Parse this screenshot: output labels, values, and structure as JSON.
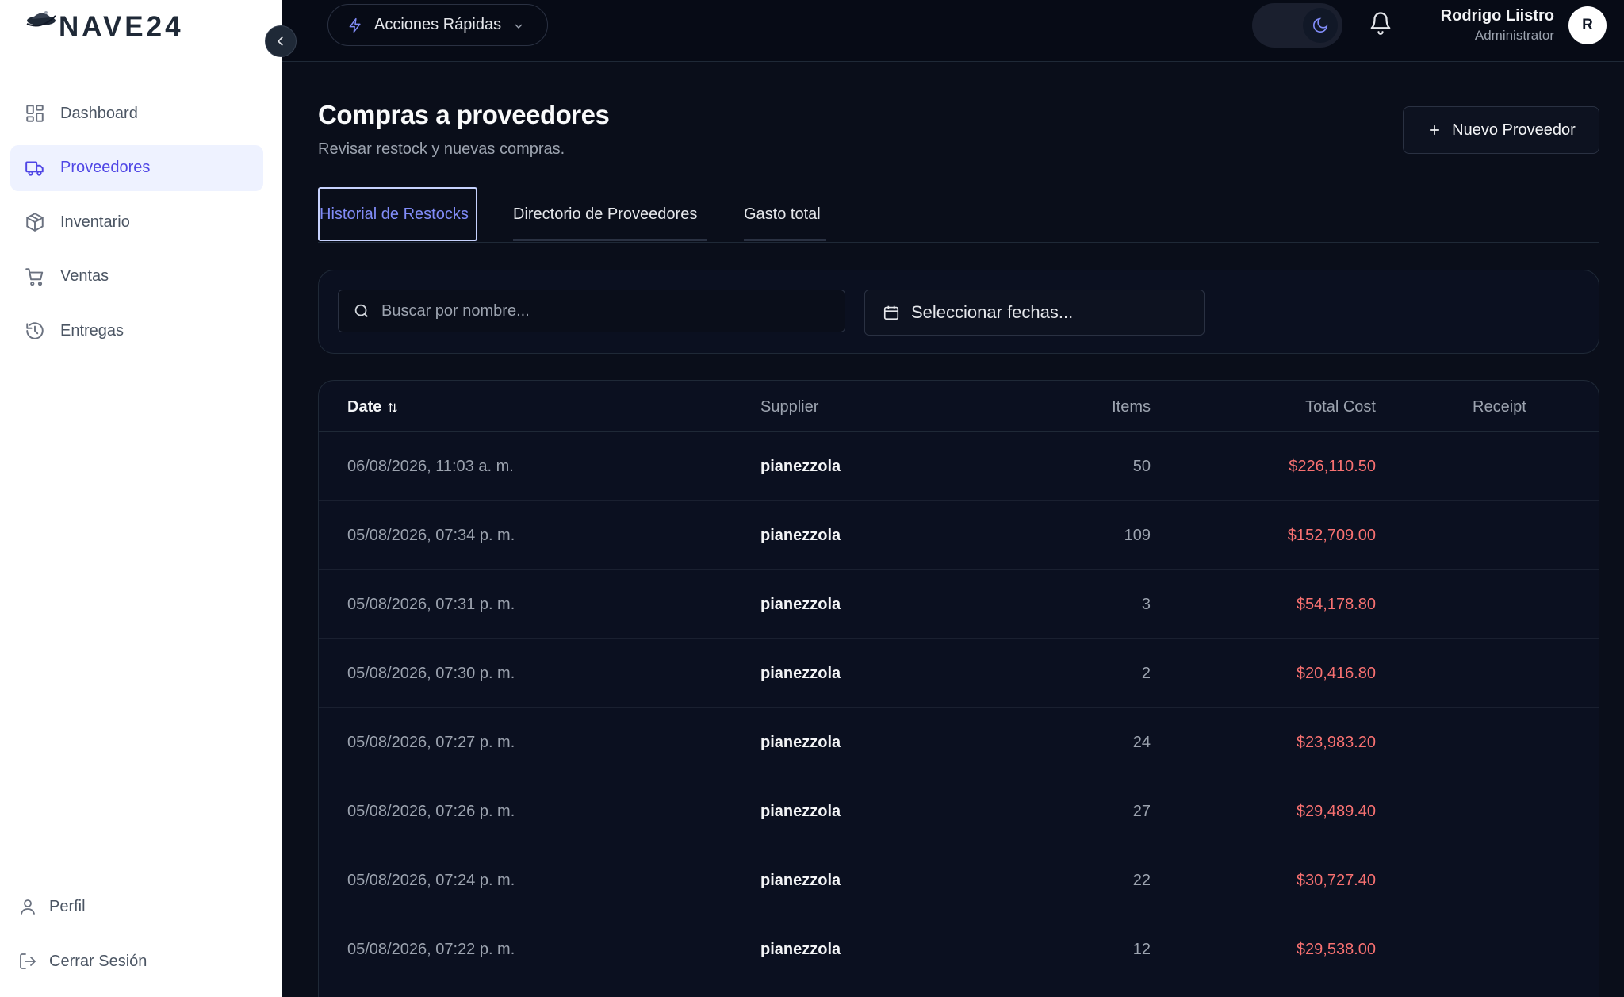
{
  "brand": {
    "name": "NAVE24"
  },
  "sidebar": {
    "items": [
      {
        "label": "Dashboard",
        "icon": "dashboard-icon"
      },
      {
        "label": "Proveedores",
        "icon": "truck-icon",
        "active": true
      },
      {
        "label": "Inventario",
        "icon": "box-icon"
      },
      {
        "label": "Ventas",
        "icon": "cart-icon"
      },
      {
        "label": "Entregas",
        "icon": "history-icon"
      }
    ],
    "bottom": [
      {
        "label": "Perfil",
        "icon": "user-icon"
      },
      {
        "label": "Cerrar Sesión",
        "icon": "logout-icon"
      }
    ]
  },
  "header": {
    "quick_actions": "Acciones Rápidas",
    "user": {
      "name": "Rodrigo Liistro",
      "role": "Administrator",
      "initial": "R"
    }
  },
  "page": {
    "title": "Compras a proveedores",
    "subtitle": "Revisar restock y nuevas compras.",
    "new_button": "Nuevo Proveedor"
  },
  "tabs": [
    {
      "label": "Historial de Restocks",
      "active": true
    },
    {
      "label": "Directorio de Proveedores"
    },
    {
      "label": "Gasto total"
    }
  ],
  "filters": {
    "search_placeholder": "Buscar por nombre...",
    "date_label": "Seleccionar fechas..."
  },
  "table": {
    "columns": {
      "date": "Date",
      "supplier": "Supplier",
      "items": "Items",
      "total": "Total Cost",
      "receipt": "Receipt"
    },
    "rows": [
      {
        "date": "06/08/2026, 11:03 a. m.",
        "supplier": "pianezzola",
        "items": "50",
        "total": "$226,110.50"
      },
      {
        "date": "05/08/2026, 07:34 p. m.",
        "supplier": "pianezzola",
        "items": "109",
        "total": "$152,709.00"
      },
      {
        "date": "05/08/2026, 07:31 p. m.",
        "supplier": "pianezzola",
        "items": "3",
        "total": "$54,178.80"
      },
      {
        "date": "05/08/2026, 07:30 p. m.",
        "supplier": "pianezzola",
        "items": "2",
        "total": "$20,416.80"
      },
      {
        "date": "05/08/2026, 07:27 p. m.",
        "supplier": "pianezzola",
        "items": "24",
        "total": "$23,983.20"
      },
      {
        "date": "05/08/2026, 07:26 p. m.",
        "supplier": "pianezzola",
        "items": "27",
        "total": "$29,489.40"
      },
      {
        "date": "05/08/2026, 07:24 p. m.",
        "supplier": "pianezzola",
        "items": "22",
        "total": "$30,727.40"
      },
      {
        "date": "05/08/2026, 07:22 p. m.",
        "supplier": "pianezzola",
        "items": "12",
        "total": "$29,538.00"
      }
    ]
  },
  "colors": {
    "accent": "#4f46e5",
    "cost": "#f87171",
    "background": "#0a0e1a"
  }
}
